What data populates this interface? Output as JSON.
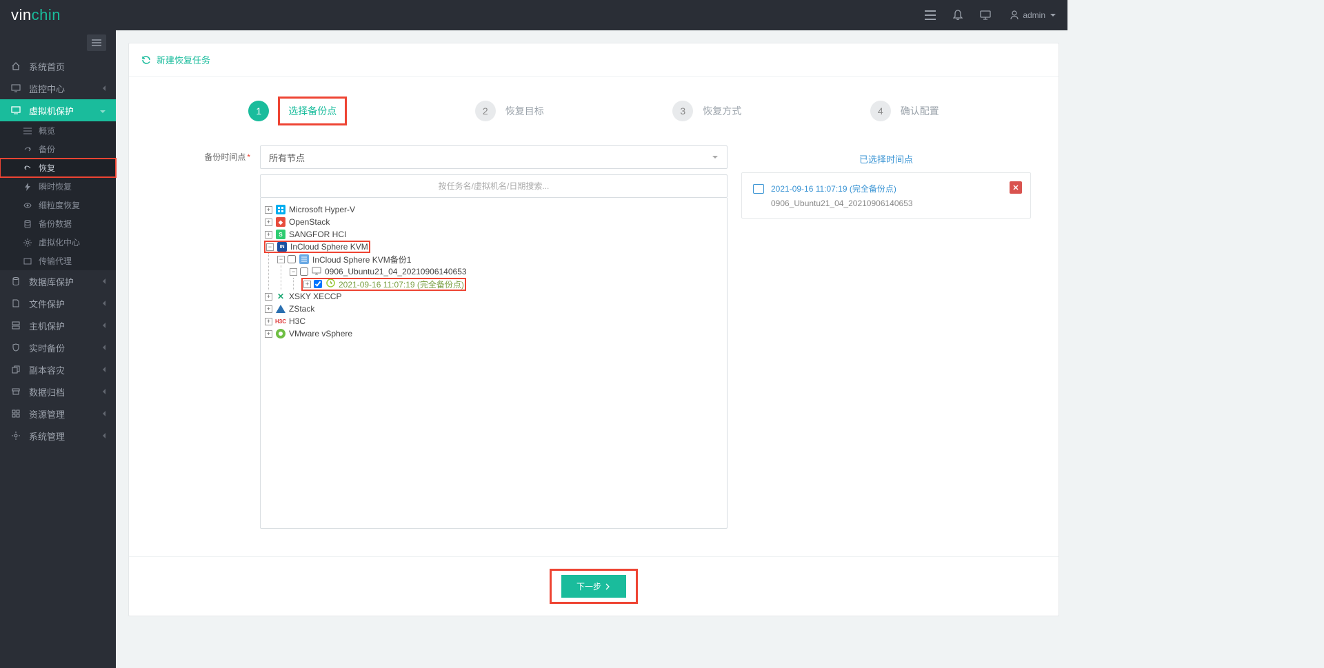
{
  "brand": {
    "part1": "vin",
    "part2": "chin"
  },
  "topbar": {
    "user": "admin"
  },
  "sidebar": {
    "items": [
      {
        "label": "系统首页"
      },
      {
        "label": "监控中心"
      },
      {
        "label": "虚拟机保护",
        "active": true
      },
      {
        "label": "数据库保护"
      },
      {
        "label": "文件保护"
      },
      {
        "label": "主机保护"
      },
      {
        "label": "实时备份"
      },
      {
        "label": "副本容灾"
      },
      {
        "label": "数据归档"
      },
      {
        "label": "资源管理"
      },
      {
        "label": "系统管理"
      }
    ],
    "sub": [
      {
        "label": "概览"
      },
      {
        "label": "备份"
      },
      {
        "label": "恢复",
        "selected": true
      },
      {
        "label": "瞬时恢复"
      },
      {
        "label": "细粒度恢复"
      },
      {
        "label": "备份数据"
      },
      {
        "label": "虚拟化中心"
      },
      {
        "label": "传输代理"
      }
    ]
  },
  "header": {
    "title": "新建恢复任务"
  },
  "steps": [
    {
      "num": "1",
      "label": "选择备份点",
      "active": true
    },
    {
      "num": "2",
      "label": "恢复目标"
    },
    {
      "num": "3",
      "label": "恢复方式"
    },
    {
      "num": "4",
      "label": "确认配置"
    }
  ],
  "form": {
    "label": "备份时间点",
    "select_value": "所有节点",
    "search_placeholder": "按任务名/虚拟机名/日期搜索..."
  },
  "tree": [
    {
      "label": "Microsoft Hyper-V",
      "icon": "hyperv"
    },
    {
      "label": "OpenStack",
      "icon": "openstack"
    },
    {
      "label": "SANGFOR HCI",
      "icon": "sangfor"
    },
    {
      "label": "InCloud Sphere KVM",
      "icon": "incloud",
      "expanded": true,
      "highlight": true,
      "children": [
        {
          "label": "InCloud Sphere KVM备份1",
          "icon": "job",
          "expanded": true,
          "checkbox": false,
          "children": [
            {
              "label": "0906_Ubuntu21_04_20210906140653",
              "icon": "vm",
              "expanded": true,
              "checkbox": false,
              "children": [
                {
                  "label": "2021-09-16 11:07:19 (完全备份点)",
                  "icon": "clock",
                  "checkbox": true,
                  "checked": true,
                  "highlight": true,
                  "green": true
                }
              ]
            }
          ]
        }
      ]
    },
    {
      "label": "XSKY XECCP",
      "icon": "xsky"
    },
    {
      "label": "ZStack",
      "icon": "zstack"
    },
    {
      "label": "H3C",
      "icon": "h3c"
    },
    {
      "label": "VMware vSphere",
      "icon": "vmware"
    }
  ],
  "selected": {
    "title": "已选择时间点",
    "line1": "2021-09-16 11:07:19 (完全备份点)",
    "line2": "0906_Ubuntu21_04_20210906140653"
  },
  "footer": {
    "next": "下一步"
  }
}
